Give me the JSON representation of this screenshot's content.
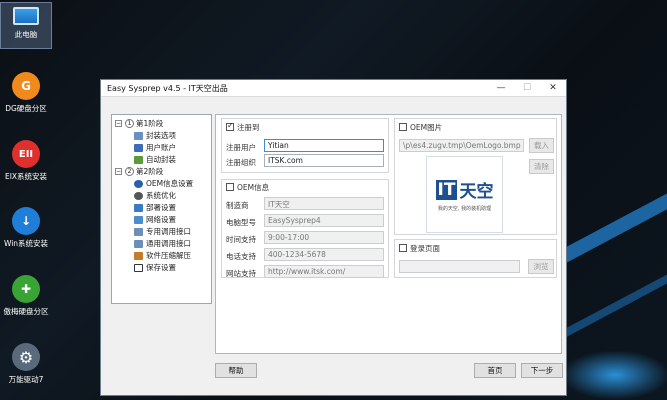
{
  "desktop": {
    "icons": [
      {
        "label": "此电脑",
        "icon": "computer-icon"
      },
      {
        "label": "DG硬盘分区",
        "icon": "dg-partition-icon",
        "glyph": "G",
        "color": "#f08a1c"
      },
      {
        "label": "EIX系统安装",
        "icon": "eix-install-icon",
        "glyph": "EII",
        "color": "#e0302e"
      },
      {
        "label": "Win系统安装",
        "icon": "win-install-icon",
        "glyph": "↓",
        "color": "#1f7fd8"
      },
      {
        "label": "傲梅硬盘分区",
        "icon": "aomei-partition-icon",
        "glyph": "✚",
        "color": "#3aa335"
      },
      {
        "label": "万能驱动7",
        "icon": "driver-icon",
        "glyph": "⚙",
        "color": "#5a6a7c"
      }
    ]
  },
  "window": {
    "title": "Easy Sysprep v4.5 - IT天空出品",
    "minimize": "—",
    "maximize": "☐",
    "close": "✕"
  },
  "tree": {
    "toggle": "−",
    "items": [
      {
        "label": "第1阶段",
        "type": "stage",
        "num": "1"
      },
      {
        "label": "封装选项",
        "color": "#6a8fc4"
      },
      {
        "label": "用户账户",
        "color": "#3d6eb5"
      },
      {
        "label": "自动封装",
        "color": "#5a9a3a"
      },
      {
        "label": "第2阶段",
        "type": "stage",
        "num": "2"
      },
      {
        "label": "OEM信息设置",
        "color": "#2a5fa8"
      },
      {
        "label": "系统优化",
        "color": "#555"
      },
      {
        "label": "部署设置",
        "color": "#3a7cc4"
      },
      {
        "label": "网络设置",
        "color": "#4a8ed0"
      },
      {
        "label": "专用调用接口",
        "color": "#6c8fb8"
      },
      {
        "label": "通用调用接口",
        "color": "#6c8fb8"
      },
      {
        "label": "软件压缩解压",
        "color": "#c47c2a"
      },
      {
        "label": "保存设置",
        "color": "#333"
      }
    ]
  },
  "register": {
    "checkbox_label": "注册到",
    "user_label": "注册用户",
    "user_value": "Yitian",
    "org_label": "注册组织",
    "org_value": "ITSK.com"
  },
  "oem_info": {
    "checkbox_label": "OEM信息",
    "fields": [
      {
        "label": "制造商",
        "value": "IT天空"
      },
      {
        "label": "电脑型号",
        "value": "EasySysprep4"
      },
      {
        "label": "时间支持",
        "value": "9:00-17:00"
      },
      {
        "label": "电话支持",
        "value": "400-1234-5678"
      },
      {
        "label": "网站支持",
        "value": "http://www.itsk.com/"
      }
    ]
  },
  "oem_image": {
    "checkbox_label": "OEM图片",
    "path": "\\p\\es4.zugv.tmp\\OemLogo.bmp",
    "load_button": "载入",
    "clear_button": "清除",
    "logo_big": "天空",
    "logo_it": "IT",
    "logo_small": "我的天空, 我的装机助理"
  },
  "login_page": {
    "checkbox_label": "登录页面",
    "browse_button": "浏览"
  },
  "footer": {
    "help": "帮助",
    "home": "首页",
    "next": "下一步"
  }
}
